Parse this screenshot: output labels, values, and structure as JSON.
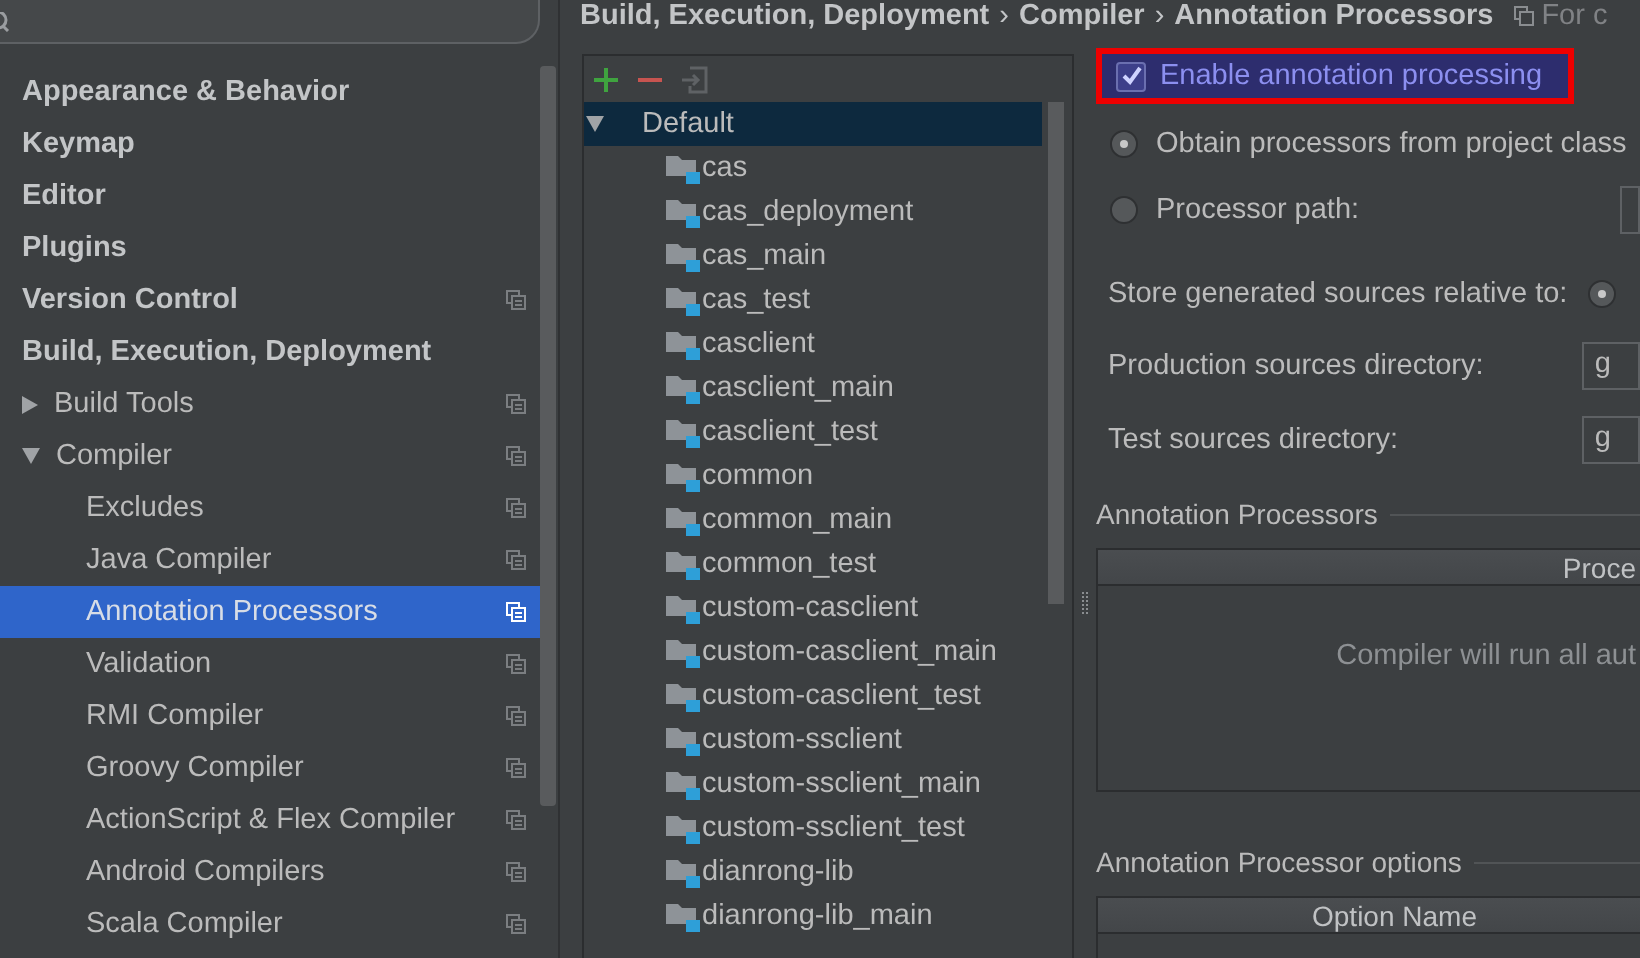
{
  "sidebar": {
    "items": [
      {
        "label": "Appearance & Behavior",
        "project_scoped": false
      },
      {
        "label": "Keymap",
        "project_scoped": false
      },
      {
        "label": "Editor",
        "project_scoped": false
      },
      {
        "label": "Plugins",
        "project_scoped": false
      },
      {
        "label": "Version Control",
        "project_scoped": true
      },
      {
        "label": "Build, Execution, Deployment",
        "project_scoped": false,
        "children": [
          {
            "label": "Build Tools",
            "expanded": false,
            "project_scoped": true
          },
          {
            "label": "Compiler",
            "expanded": true,
            "project_scoped": true,
            "children": [
              {
                "label": "Excludes",
                "selected": false,
                "project_scoped": true
              },
              {
                "label": "Java Compiler",
                "selected": false,
                "project_scoped": true
              },
              {
                "label": "Annotation Processors",
                "selected": true,
                "project_scoped": true
              },
              {
                "label": "Validation",
                "selected": false,
                "project_scoped": true
              },
              {
                "label": "RMI Compiler",
                "selected": false,
                "project_scoped": true
              },
              {
                "label": "Groovy Compiler",
                "selected": false,
                "project_scoped": true
              },
              {
                "label": "ActionScript & Flex Compiler",
                "selected": false,
                "project_scoped": true
              },
              {
                "label": "Android Compilers",
                "selected": false,
                "project_scoped": true
              },
              {
                "label": "Scala Compiler",
                "selected": false,
                "project_scoped": true
              }
            ]
          }
        ]
      }
    ]
  },
  "breadcrumb": [
    {
      "kind": "crumb",
      "text": "Build, Execution, Deployment"
    },
    {
      "kind": "separator",
      "text": "›"
    },
    {
      "kind": "crumb",
      "text": "Compiler"
    },
    {
      "kind": "separator",
      "text": "›"
    },
    {
      "kind": "crumb",
      "text": "Annotation Processors"
    },
    {
      "kind": "note",
      "text": "For c"
    }
  ],
  "module_toolbar": [
    {
      "kind": "add",
      "disabled": false
    },
    {
      "kind": "remove",
      "disabled": false
    },
    {
      "kind": "import",
      "disabled": true
    }
  ],
  "module_tree": {
    "label": "Default",
    "expanded": true,
    "selected": true,
    "children": [
      {
        "label": "cas",
        "selected": false
      },
      {
        "label": "cas_deployment",
        "selected": false
      },
      {
        "label": "cas_main",
        "selected": false
      },
      {
        "label": "cas_test",
        "selected": false
      },
      {
        "label": "casclient",
        "selected": false
      },
      {
        "label": "casclient_main",
        "selected": false
      },
      {
        "label": "casclient_test",
        "selected": false
      },
      {
        "label": "common",
        "selected": false
      },
      {
        "label": "common_main",
        "selected": false
      },
      {
        "label": "common_test",
        "selected": false
      },
      {
        "label": "custom-casclient",
        "selected": false
      },
      {
        "label": "custom-casclient_main",
        "selected": false
      },
      {
        "label": "custom-casclient_test",
        "selected": false
      },
      {
        "label": "custom-ssclient",
        "selected": false
      },
      {
        "label": "custom-ssclient_main",
        "selected": false
      },
      {
        "label": "custom-ssclient_test",
        "selected": false
      },
      {
        "label": "dianrong-lib",
        "selected": false
      },
      {
        "label": "dianrong-lib_main",
        "selected": false
      }
    ]
  },
  "enable_processing": {
    "label": "Enable annotation processing",
    "checked": true,
    "highlighted": true
  },
  "processor_source": [
    {
      "label": "Obtain processors from project class",
      "selected": true
    },
    {
      "label": "Processor path:",
      "selected": false
    }
  ],
  "store_relative": {
    "label": "Store generated sources relative to:",
    "selected": true
  },
  "directories": [
    {
      "label": "Production sources directory:",
      "value": "g"
    },
    {
      "label": "Test sources directory:",
      "value": "g"
    }
  ],
  "processors_section": {
    "title": "Annotation Processors",
    "column_1": "Proce",
    "empty_text": "Compiler will run all aut"
  },
  "options_section": {
    "title": "Annotation Processor options",
    "column_1": "Option Name"
  }
}
